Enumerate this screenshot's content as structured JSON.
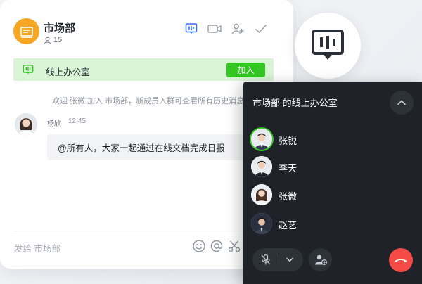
{
  "chat": {
    "title": "市场部",
    "member_count": "15",
    "office_bar": {
      "label": "线上办公室",
      "join_label": "加入"
    },
    "system_message": "欢迎 张微 加入 市场部，新成员入群可查看所有历史消息",
    "message": {
      "sender": "杨欣",
      "time": "12:45",
      "text": "@所有人，大家一起通过在线文档完成日报"
    },
    "compose_placeholder": "发给 市场部"
  },
  "panel": {
    "title": "市场部 的线上办公室",
    "participants": [
      {
        "name": "张锐",
        "speaking": true
      },
      {
        "name": "李天",
        "speaking": false
      },
      {
        "name": "张微",
        "speaking": false
      },
      {
        "name": "赵艺",
        "speaking": false
      }
    ]
  },
  "colors": {
    "accent_green": "#34c724",
    "office_bar_bg": "#d9f5d6",
    "group_avatar": "#f5a623",
    "panel_bg": "#1f2228",
    "hangup_red": "#f54a45",
    "header_icon_blue": "#3370ff"
  },
  "icons": {
    "header": [
      "meeting-room-icon",
      "video-camera-icon",
      "add-member-icon",
      "check-icon"
    ],
    "compose_tools": [
      "emoji-icon",
      "at-mention-icon",
      "scissors-icon"
    ]
  }
}
